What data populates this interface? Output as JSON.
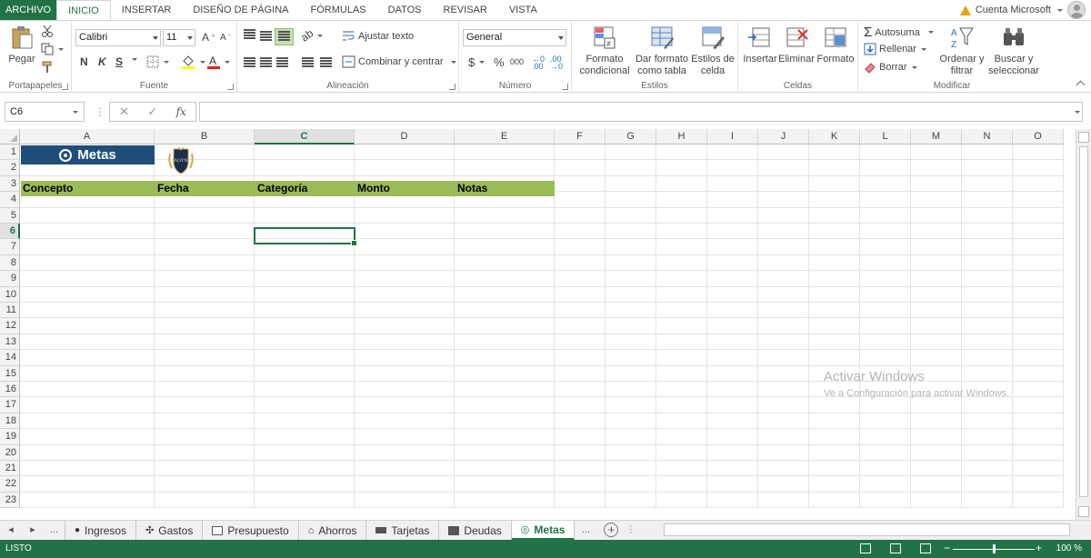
{
  "ribbon_tabs": [
    "ARCHIVO",
    "INICIO",
    "INSERTAR",
    "DISEÑO DE PÁGINA",
    "FÓRMULAS",
    "DATOS",
    "REVISAR",
    "VISTA"
  ],
  "active_tab": "INICIO",
  "account": {
    "label": "Cuenta Microsoft"
  },
  "clipboard": {
    "paste": "Pegar",
    "group": "Portapapeles"
  },
  "font": {
    "name": "Calibri",
    "size": "11",
    "bold": "N",
    "italic": "K",
    "underline": "S",
    "group": "Fuente"
  },
  "alignment": {
    "wrap": "Ajustar texto",
    "merge": "Combinar y centrar",
    "group": "Alineación"
  },
  "number": {
    "format": "General",
    "currency": "$",
    "percent": "%",
    "thousands": "000",
    "group": "Número"
  },
  "styles": {
    "conditional": "Formato condicional",
    "table": "Dar formato como tabla",
    "cell": "Estilos de celda",
    "group": "Estilos"
  },
  "cells": {
    "insert": "Insertar",
    "delete": "Eliminar",
    "format": "Formato",
    "group": "Celdas"
  },
  "editing": {
    "autosum": "Autosuma",
    "fill": "Rellenar",
    "clear": "Borrar",
    "sort": "Ordenar y filtrar",
    "find": "Buscar y seleccionar",
    "group": "Modificar"
  },
  "formula_bar": {
    "name_box": "C6",
    "fx": "fx",
    "value": ""
  },
  "columns": [
    "A",
    "B",
    "C",
    "D",
    "E",
    "F",
    "G",
    "H",
    "I",
    "J",
    "K",
    "L",
    "M",
    "N",
    "O"
  ],
  "selected_column": "C",
  "rows": [
    "1",
    "2",
    "3",
    "4",
    "5",
    "6",
    "7",
    "8",
    "9",
    "10",
    "11",
    "12",
    "13",
    "14",
    "15",
    "16",
    "17",
    "18",
    "19",
    "20",
    "21",
    "22",
    "23"
  ],
  "selected_row": "6",
  "sheet": {
    "title_cell": "Metas",
    "logo_text": "AGYN",
    "headers": [
      "Concepto",
      "Fecha",
      "Categoría",
      "Monto",
      "Notas"
    ],
    "header_color": "#9bbb59",
    "title_color": "#1f4e79"
  },
  "sheet_tabs": [
    "Ingresos",
    "Gastos",
    "Presupuesto",
    "Ahorros",
    "Tarjetas",
    "Deudas",
    "Metas"
  ],
  "active_sheet": "Metas",
  "watermark": {
    "line1": "Activar Windows",
    "line2": "Ve a Configuración para activar Windows."
  },
  "status": {
    "text": "LISTO",
    "zoom": "100 %"
  },
  "accent": "#217346"
}
